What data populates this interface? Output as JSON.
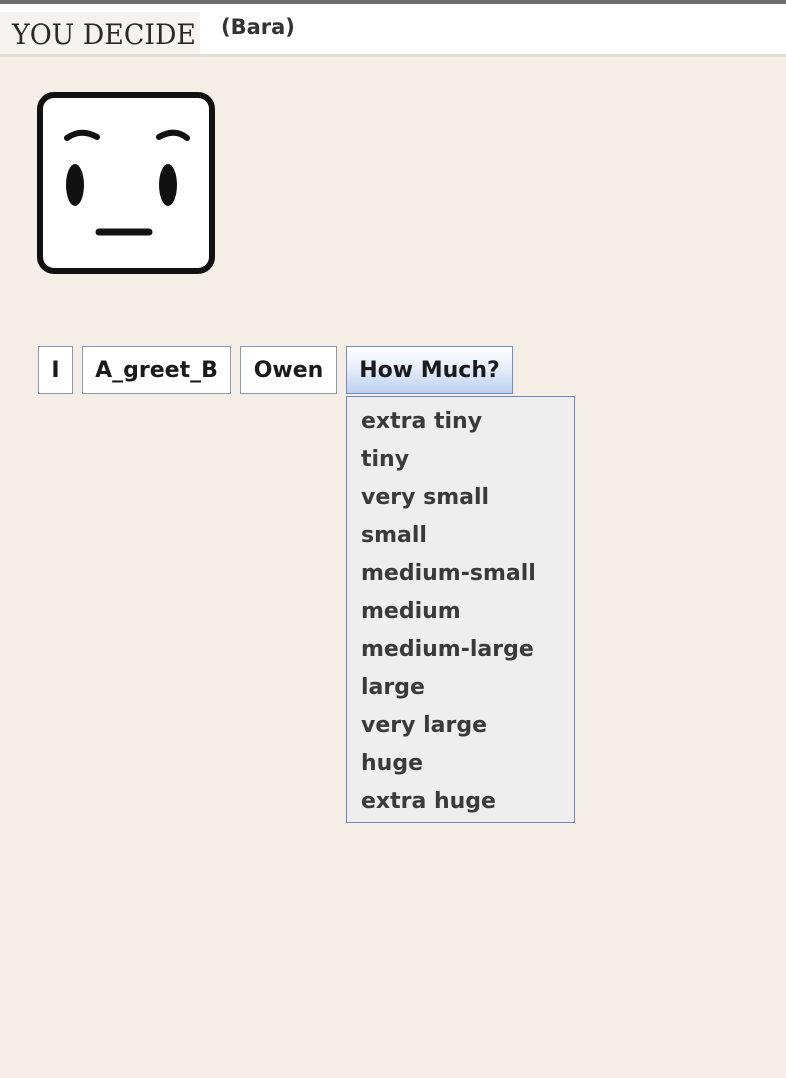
{
  "header": {
    "logo_text": "You Decide",
    "player_name": "(Bara)"
  },
  "character": {
    "icon": "neutral-face-icon"
  },
  "sentence": {
    "words": [
      "I",
      "A_greet_B",
      "Owen",
      "How Much?"
    ]
  },
  "dropdown": {
    "options": [
      "extra tiny",
      "tiny",
      "very small",
      "small",
      "medium-small",
      "medium",
      "medium-large",
      "large",
      "very large",
      "huge",
      "extra huge"
    ]
  },
  "colors": {
    "background": "#f4eee7",
    "header_background": "#ffffff",
    "button_border": "#8a9ab5",
    "active_button_gradient_end": "#bcd0ef",
    "dropdown_background": "#eeeeee",
    "dropdown_border": "#6b86c0"
  }
}
